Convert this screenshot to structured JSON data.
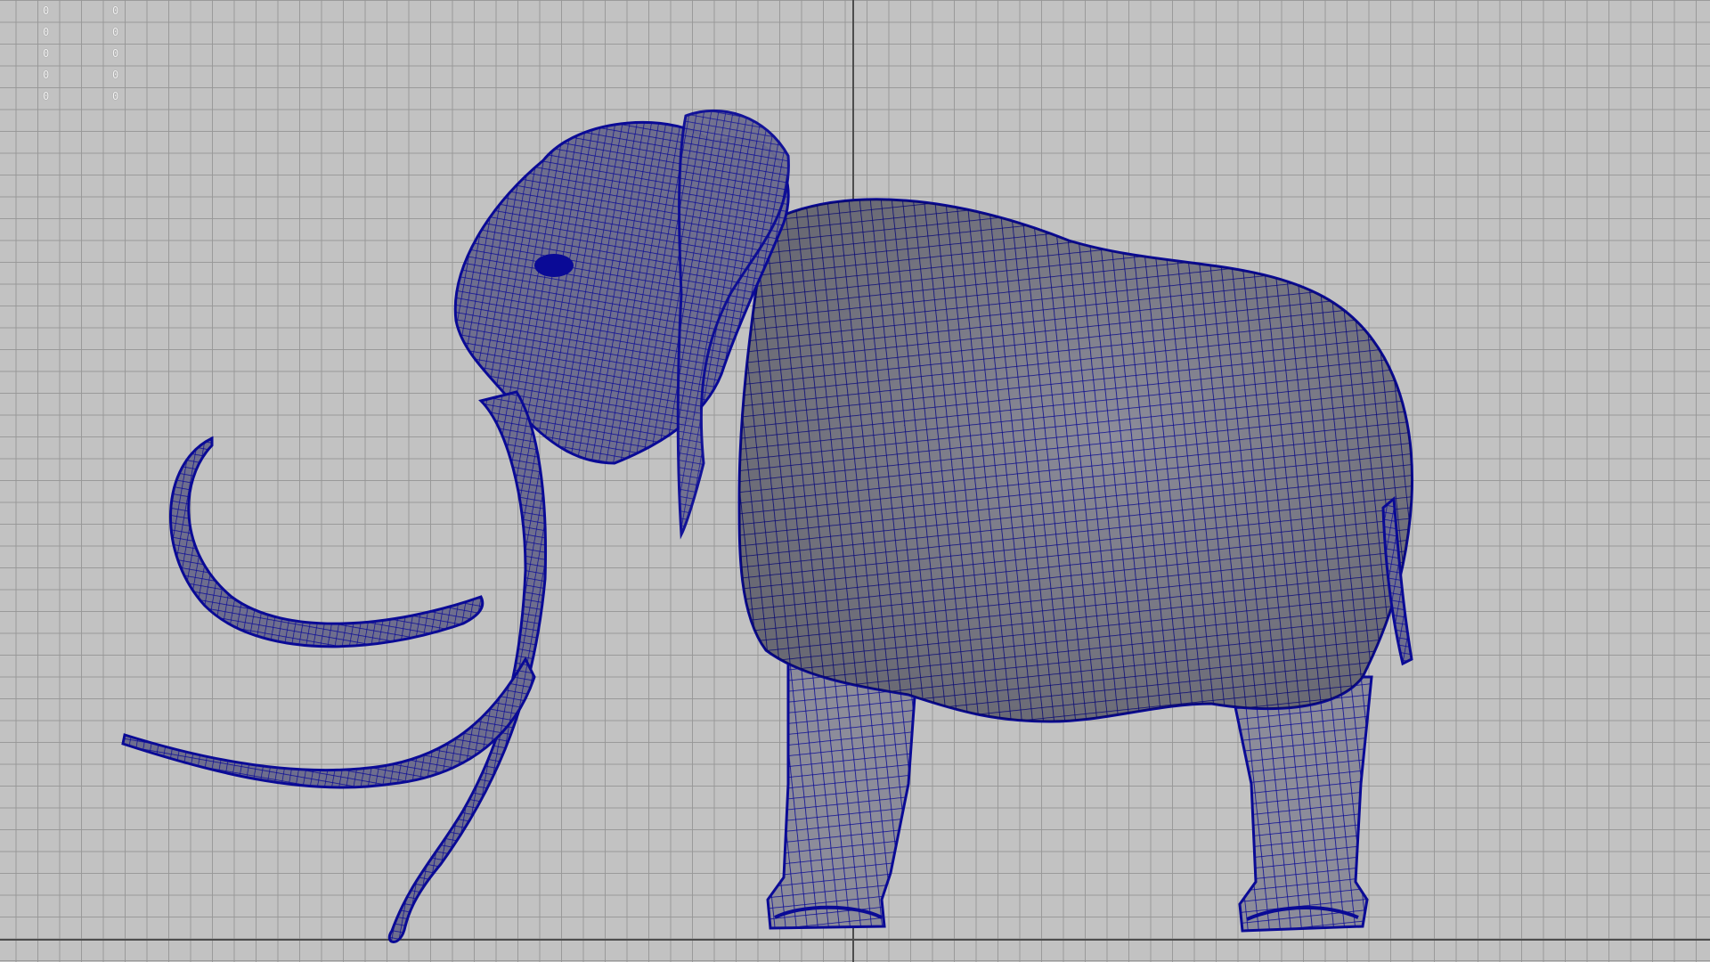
{
  "viewport": {
    "view": "side-orthographic",
    "background_color": "#c2c2c2",
    "grid_color": "#969696",
    "axis_color": "#4c4c4c"
  },
  "hud": {
    "column_a": [
      "0",
      "0",
      "0",
      "0",
      "0"
    ],
    "column_b": [
      "0",
      "0",
      "0",
      "0",
      "0"
    ]
  },
  "model": {
    "icon": "wireframe-mammoth",
    "mesh_color": "#0a0a96",
    "shade_color": "#8a8a8a"
  }
}
